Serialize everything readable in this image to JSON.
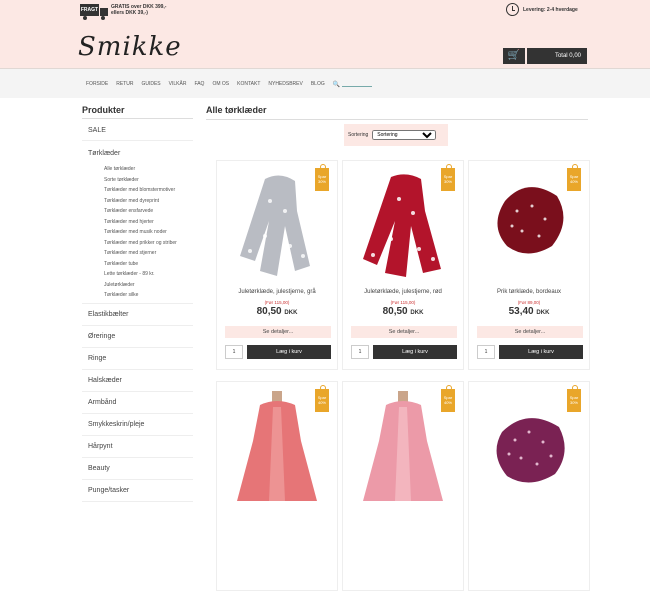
{
  "topbar": {
    "shipping_badge": "FRAGT",
    "shipping_line1": "GRATIS over DKK 399,-",
    "shipping_line2": "ellers DKK 39,-)",
    "delivery": "Levering: 2-4 hverdage"
  },
  "logo": "Smikke",
  "cart": {
    "icon": "cart-icon",
    "total": "Total 0,00"
  },
  "nav": {
    "items": [
      "FORSIDE",
      "RETUR",
      "GUIDES",
      "VILKÅR",
      "FAQ",
      "OM OS",
      "KONTAKT",
      "NYHEDSBREV",
      "BLOG"
    ]
  },
  "sidebar": {
    "title": "Produkter",
    "sale": "SALE",
    "scarves": "Tørklæder",
    "sub": [
      "Alle tørklæder",
      "Sorte tørklæder",
      "Tørklæder med blomstermotiver",
      "Tørklæder med dyreprint",
      "Tørklæder ensfarvede",
      "Tørklæder med hjerter",
      "Tørklæder med musik noder",
      "Tørklæder med prikker og striber",
      "Tørklæder med stjerner",
      "Tørklæder tube",
      "Lette tørklæder - 89 kr.",
      "Juletørklæder",
      "Tørklæder silke"
    ],
    "cats": [
      "Elastikbælter",
      "Øreringe",
      "Ringe",
      "Halskæder",
      "Armbånd",
      "Smykkeskrin/pleje",
      "Hårpynt",
      "Beauty",
      "Punge/tasker"
    ]
  },
  "main": {
    "title": "Alle tørklæder",
    "sort_label": "Sortering",
    "sort_value": "Sortering",
    "products": [
      {
        "name": "Juletørklæde, julestjerne, grå",
        "old": "(Før 115,00)",
        "price": "80,50",
        "cur": "DKK",
        "badge_word": "Spar",
        "badge_pct": "30%",
        "color": "#b9bcc3"
      },
      {
        "name": "Juletørklæde, julestjerne, rød",
        "old": "(Før 115,00)",
        "price": "80,50",
        "cur": "DKK",
        "badge_word": "Spar",
        "badge_pct": "30%",
        "color": "#b3142b"
      },
      {
        "name": "Prik tørklæde, bordeaux",
        "old": "(Før 89,00)",
        "price": "53,40",
        "cur": "DKK",
        "badge_word": "Spar",
        "badge_pct": "40%",
        "color": "#7a0f1c"
      },
      {
        "badge_word": "Spar",
        "badge_pct": "40%",
        "color": "#e67577"
      },
      {
        "badge_word": "Spar",
        "badge_pct": "40%",
        "color": "#ec9aa8"
      },
      {
        "badge_word": "Spar",
        "badge_pct": "30%",
        "color": "#7a2253"
      }
    ],
    "details_label": "Se detaljer...",
    "qty": "1",
    "buy_label": "Læg i kurv"
  }
}
